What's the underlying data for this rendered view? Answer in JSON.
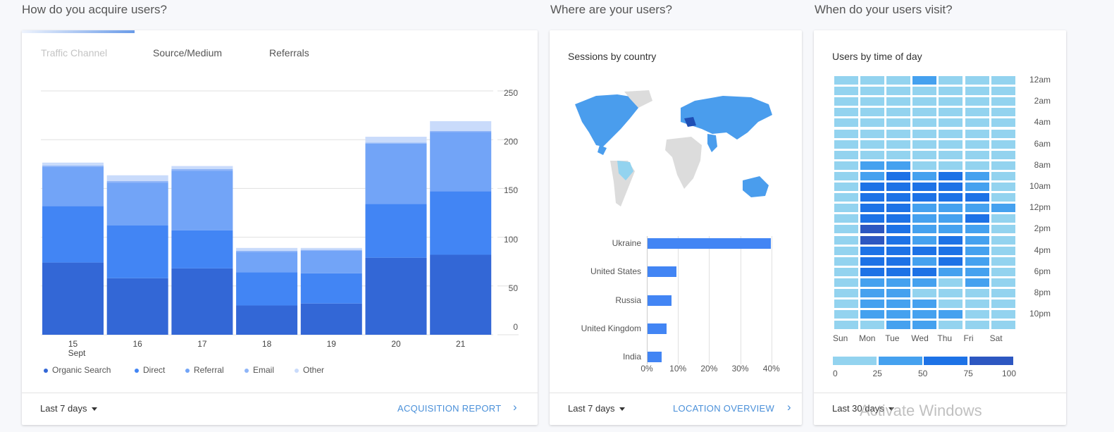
{
  "sections": {
    "acquire": "How do you acquire users?",
    "where": "Where are your users?",
    "when": "When do your users visit?"
  },
  "acquisition": {
    "tabs": [
      "Traffic Channel",
      "Source/Medium",
      "Referrals"
    ],
    "range": "Last 7 days",
    "report_link": "ACQUISITION REPORT",
    "legend": [
      "Organic Search",
      "Direct",
      "Referral",
      "Email",
      "Other"
    ],
    "month_label": "Sept"
  },
  "location": {
    "title": "Sessions by country",
    "range": "Last 7 days",
    "report_link": "LOCATION OVERVIEW"
  },
  "time": {
    "title": "Users by time of day",
    "range": "Last 30 days"
  },
  "watermark": "Activate Windows",
  "colors": {
    "organic": "#3367d6",
    "direct": "#4285f4",
    "referral": "#72a4f7",
    "email": "#8fb5f8",
    "other": "#c9dbfb",
    "heat": [
      "#93d3ef",
      "#45a1ef",
      "#1d72e6",
      "#2d57c1"
    ]
  },
  "chart_data": [
    {
      "type": "bar",
      "stacked": true,
      "title": "Traffic Channel",
      "categories": [
        "15",
        "16",
        "17",
        "18",
        "19",
        "20",
        "21"
      ],
      "yticks": [
        "0",
        "50",
        "100",
        "150",
        "200",
        "250"
      ],
      "ylim": [
        0,
        250
      ],
      "legend": "bottom",
      "series": [
        {
          "name": "Organic Search",
          "values": [
            74,
            58,
            68,
            30,
            32,
            79,
            82
          ]
        },
        {
          "name": "Direct",
          "values": [
            58,
            54,
            39,
            34,
            31,
            55,
            65
          ]
        },
        {
          "name": "Referral",
          "values": [
            40,
            44,
            61,
            21,
            23,
            62,
            61
          ]
        },
        {
          "name": "Email",
          "values": [
            1.5,
            1.5,
            2,
            1,
            1,
            1,
            1
          ]
        },
        {
          "name": "Other",
          "values": [
            3,
            6,
            3,
            3,
            2,
            6,
            10
          ]
        }
      ]
    },
    {
      "type": "bar",
      "orientation": "horizontal",
      "title": "Sessions by country",
      "categories": [
        "Ukraine",
        "United States",
        "Russia",
        "United Kingdom",
        "India"
      ],
      "values": [
        39.6,
        9.2,
        7.6,
        6.2,
        4.6
      ],
      "xticks": [
        "0%",
        "10%",
        "20%",
        "30%",
        "40%"
      ],
      "xlim": [
        0,
        40
      ]
    },
    {
      "type": "heatmap",
      "title": "Users by time of day",
      "columns": [
        "Sun",
        "Mon",
        "Tue",
        "Wed",
        "Thu",
        "Fri",
        "Sat"
      ],
      "row_labels": [
        "12am",
        "2am",
        "4am",
        "6am",
        "8am",
        "10am",
        "12pm",
        "2pm",
        "4pm",
        "6pm",
        "8pm",
        "10pm"
      ],
      "scale_labels": [
        "0",
        "25",
        "50",
        "75",
        "100"
      ],
      "levels": [
        [
          0,
          0,
          0,
          1,
          0,
          0,
          0
        ],
        [
          0,
          0,
          0,
          0,
          0,
          0,
          0
        ],
        [
          0,
          0,
          0,
          0,
          0,
          0,
          0
        ],
        [
          0,
          0,
          0,
          0,
          0,
          0,
          0
        ],
        [
          0,
          0,
          0,
          0,
          0,
          0,
          0
        ],
        [
          0,
          0,
          0,
          0,
          0,
          0,
          0
        ],
        [
          0,
          0,
          0,
          0,
          0,
          0,
          0
        ],
        [
          0,
          0,
          0,
          0,
          0,
          0,
          0
        ],
        [
          0,
          1,
          1,
          0,
          0,
          0,
          0
        ],
        [
          0,
          1,
          2,
          1,
          2,
          1,
          0
        ],
        [
          0,
          2,
          2,
          2,
          2,
          1,
          0
        ],
        [
          0,
          2,
          2,
          2,
          2,
          2,
          0
        ],
        [
          0,
          2,
          2,
          1,
          1,
          1,
          1
        ],
        [
          0,
          2,
          2,
          1,
          1,
          2,
          0
        ],
        [
          0,
          3,
          2,
          1,
          1,
          1,
          0
        ],
        [
          0,
          3,
          2,
          1,
          2,
          1,
          0
        ],
        [
          0,
          2,
          2,
          2,
          2,
          1,
          0
        ],
        [
          0,
          2,
          2,
          1,
          2,
          1,
          0
        ],
        [
          0,
          2,
          2,
          2,
          1,
          1,
          0
        ],
        [
          0,
          1,
          1,
          1,
          0,
          1,
          0
        ],
        [
          0,
          1,
          1,
          0,
          0,
          0,
          0
        ],
        [
          0,
          1,
          1,
          1,
          0,
          0,
          0
        ],
        [
          0,
          1,
          1,
          1,
          1,
          0,
          0
        ],
        [
          0,
          0,
          1,
          1,
          0,
          0,
          0
        ]
      ]
    }
  ]
}
